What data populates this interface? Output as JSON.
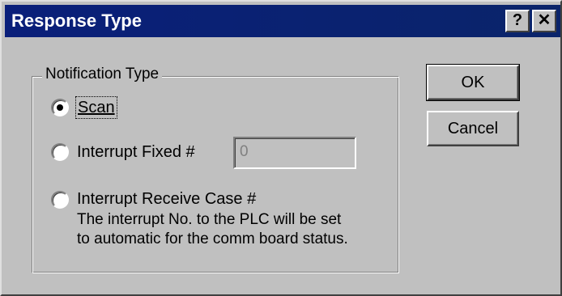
{
  "window": {
    "title": "Response Type",
    "help_glyph": "?",
    "close_glyph": "✕"
  },
  "group": {
    "label": "Notification Type",
    "options": [
      {
        "label": "Scan",
        "checked": true
      },
      {
        "label": "Interrupt Fixed #",
        "checked": false
      },
      {
        "label": "Interrupt Receive Case #",
        "checked": false
      }
    ],
    "interrupt_fixed_value": "0",
    "description_line1": "The interrupt No. to the PLC will be set",
    "description_line2": "to automatic for the comm board status."
  },
  "buttons": {
    "ok": "OK",
    "cancel": "Cancel"
  }
}
